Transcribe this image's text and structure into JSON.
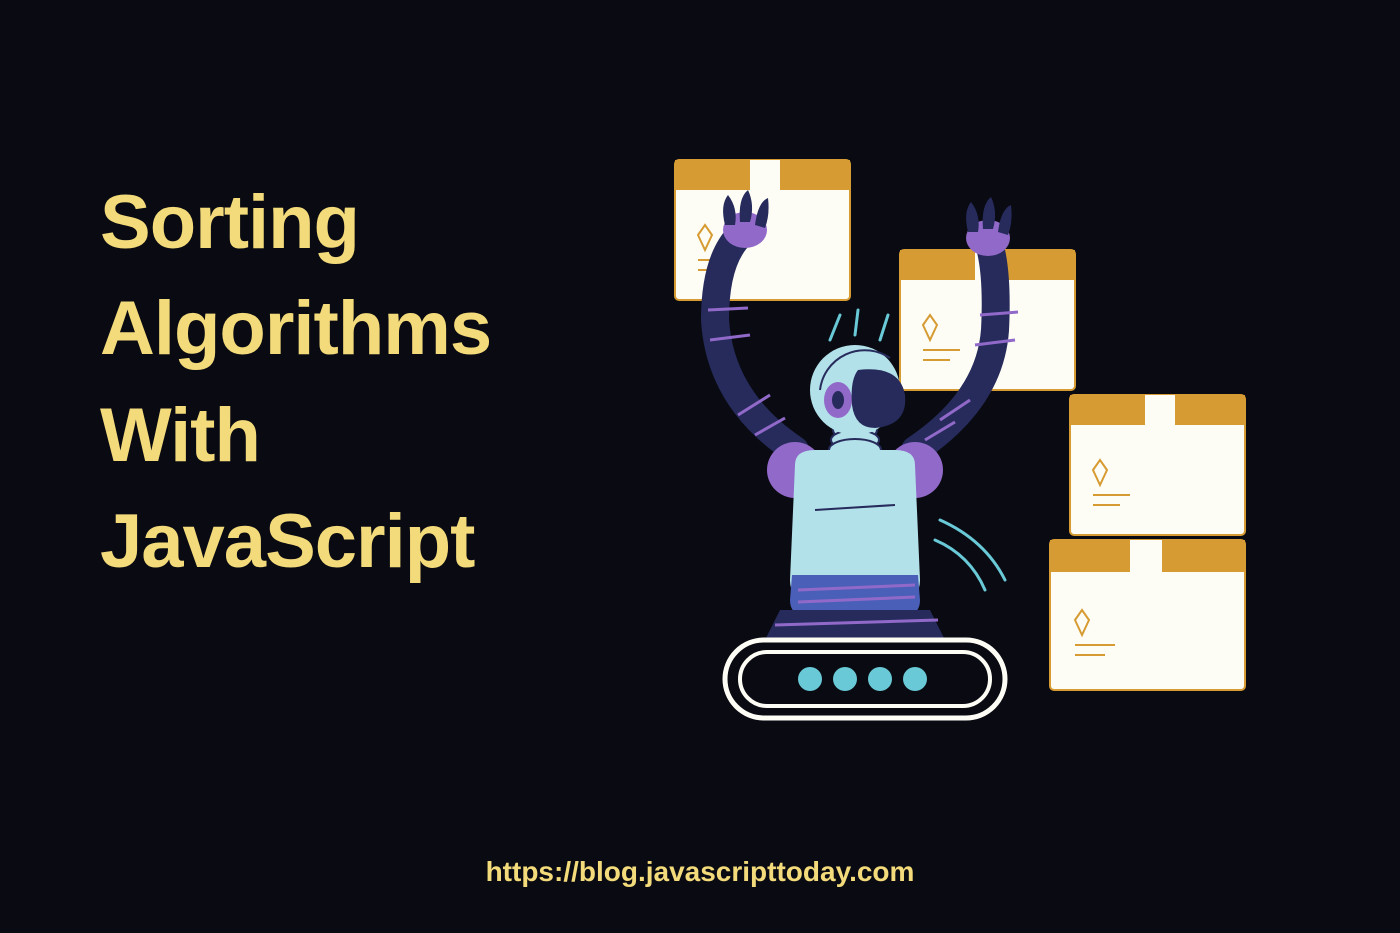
{
  "title": "Sorting Algorithms With JavaScript",
  "url": "https://blog.javascripttoday.com",
  "colors": {
    "background": "#0a0b12",
    "accent": "#f3da7a",
    "boxFill": "#fefdf5",
    "boxAccent": "#d69b32",
    "robotLight": "#b3e1ea",
    "robotTeal": "#69c9d7",
    "robotDark": "#262b5c",
    "robotPurple": "#9169c9",
    "robotBlue": "#4a5fb8"
  }
}
